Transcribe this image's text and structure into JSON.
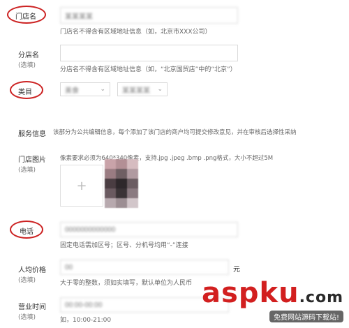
{
  "form": {
    "store_name": {
      "label": "门店名",
      "value": "某某某某",
      "hint": "门店名不得含有区域地址信息（如，北京市XXX公司）"
    },
    "branch_name": {
      "label": "分店名",
      "optional": "(选填)",
      "value": "",
      "hint": "分店名不得含有区域地址信息（如，“北京国贸店”中的“北京”）"
    },
    "category": {
      "label": "类目",
      "select1": "美食",
      "select2": "某某某某"
    },
    "service_info": {
      "label": "服务信息",
      "text": "该部分为公共编辑信息，每个添加了该门店的商户均可提交修改意见，并在审核后选择性采纳"
    },
    "store_image": {
      "label": "门店图片",
      "optional": "(选填)",
      "hint": "像素要求必须为640*340像素，支持.jpg .jpeg .bmp .png格式，大小不超过5M",
      "add_symbol": "+"
    },
    "phone": {
      "label": "电话",
      "value": "0000000000000",
      "hint": "固定电话需加区号；区号、分机号均用“-”连接"
    },
    "avg_price": {
      "label": "人均价格",
      "optional": "(选填)",
      "value": "00",
      "unit": "元",
      "hint": "大于零的整数，须如实填写，默认单位为人民币"
    },
    "business_hours": {
      "label": "营业时间",
      "optional": "(选填)",
      "value": "00:00-00:00",
      "hint": "如，10:00-21:00"
    }
  },
  "watermark": {
    "brand": "aspku",
    "suffix": ".com",
    "tagline": "免费网站源码下载站!"
  },
  "colors": {
    "annotation_red": "#cc2222",
    "wm_red": "#d21f1f",
    "wm_dark": "#2a2a2a"
  }
}
